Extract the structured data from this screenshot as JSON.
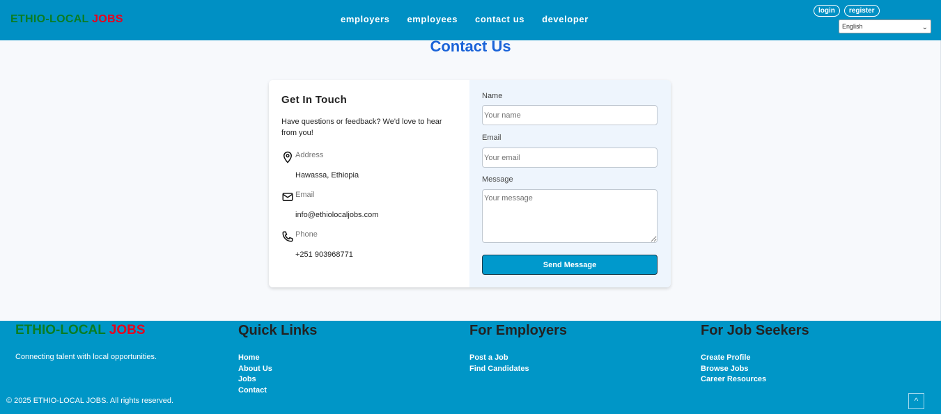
{
  "header": {
    "logo_part1": "ETHIO-LOCAL",
    "logo_part2": "JOBS",
    "nav": [
      "employers",
      "employees",
      "contact us",
      "developer"
    ],
    "login_label": "login",
    "register_label": "register",
    "language_selected": "English"
  },
  "page": {
    "title": "Contact Us"
  },
  "contact_info": {
    "heading": "Get In Touch",
    "intro": "Have questions or feedback? We'd love to hear from you!",
    "address_label": "Address",
    "address_value": "Hawassa, Ethiopia",
    "email_label": "Email",
    "email_value": "info@ethiolocaljobs.com",
    "phone_label": "Phone",
    "phone_value": "+251 903968771"
  },
  "form": {
    "name_label": "Name",
    "name_placeholder": "Your name",
    "email_label": "Email",
    "email_placeholder": "Your email",
    "message_label": "Message",
    "message_placeholder": "Your message",
    "submit_label": "Send Message"
  },
  "footer": {
    "logo_part1": "ETHIO-LOCAL",
    "logo_part2": "JOBS",
    "tagline": "Connecting talent with local opportunities.",
    "quick_links_heading": "Quick Links",
    "quick_links": [
      "Home",
      "About Us",
      "Jobs",
      "Contact"
    ],
    "employers_heading": "For Employers",
    "employers_links": [
      "Post a Job",
      "Find Candidates"
    ],
    "seekers_heading": "For Job Seekers",
    "seekers_links": [
      "Create Profile",
      "Browse Jobs",
      "Career Resources"
    ],
    "copyright": "© 2025 ETHIO-LOCAL JOBS. All rights reserved."
  },
  "colors": {
    "header_bg": "#0090c4",
    "footer_bg": "#0096c7",
    "title_blue": "#1a63d8",
    "logo_green": "#0a7d23",
    "logo_red": "#e8001c",
    "button_bg": "#0099cc"
  }
}
